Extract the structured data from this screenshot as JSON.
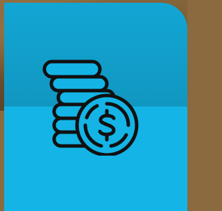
{
  "background": {
    "photo_color": "#7a5c35"
  },
  "card": {
    "color": "#14b4e6",
    "icon": "coin-stack-dollar-icon",
    "icon_stroke_color": "#111111"
  }
}
